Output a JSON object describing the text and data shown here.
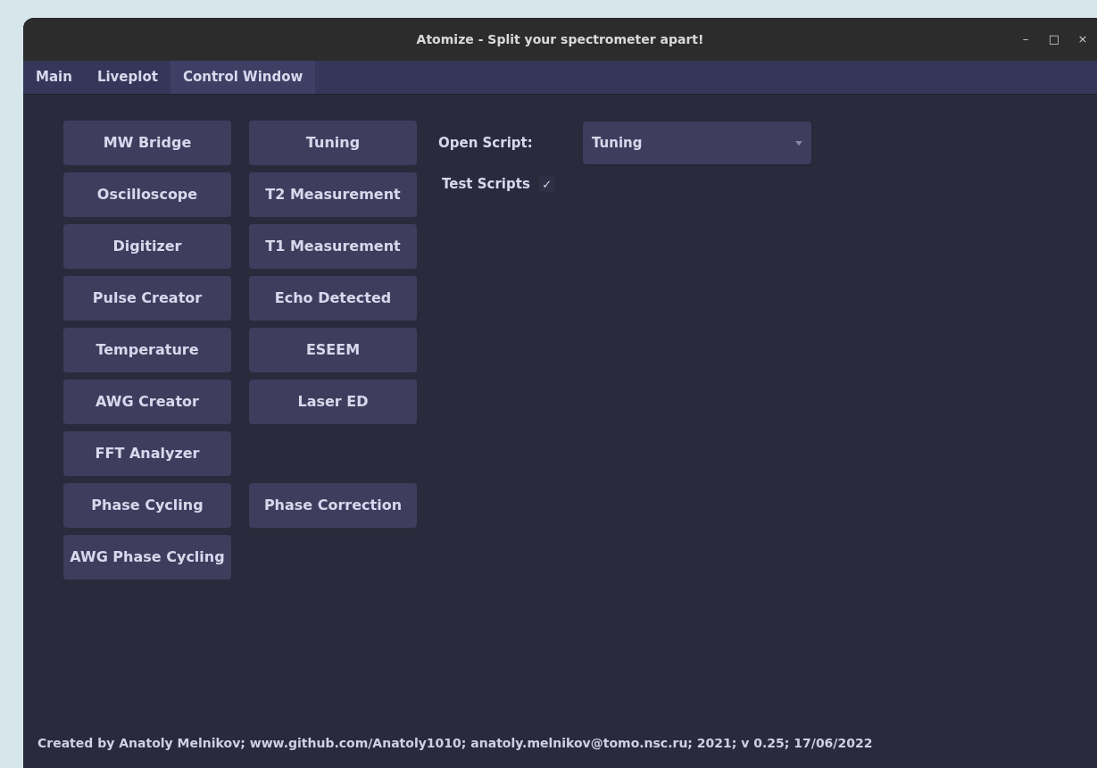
{
  "window": {
    "title": "Atomize - Split your spectrometer apart!",
    "controls": [
      "–",
      "□",
      "×"
    ]
  },
  "tabs": [
    {
      "label": "Main",
      "selected": false
    },
    {
      "label": "Liveplot",
      "selected": false
    },
    {
      "label": "Control Window",
      "selected": true
    }
  ],
  "button_rows": [
    {
      "left": "MW Bridge",
      "right": "Tuning"
    },
    {
      "left": "Oscilloscope",
      "right": "T2 Measurement"
    },
    {
      "left": "Digitizer",
      "right": "T1 Measurement"
    },
    {
      "left": "Pulse Creator",
      "right": "Echo Detected"
    },
    {
      "left": "Temperature",
      "right": "ESEEM"
    },
    {
      "left": "AWG Creator",
      "right": "Laser ED"
    },
    {
      "left": "FFT Analyzer"
    },
    {
      "left": "Phase Cycling",
      "right": "Phase Correction"
    },
    {
      "left": "AWG Phase Cycling"
    }
  ],
  "open_script": {
    "label": "Open Script:",
    "value": "Tuning"
  },
  "test_scripts": {
    "label": "Test Scripts",
    "mark": "✓",
    "checked": true
  },
  "footer": "Created by Anatoly Melnikov; www.github.com/Anatoly1010; anatoly.melnikov@tomo.nsc.ru; 2021; v 0.25; 17/06/2022"
}
